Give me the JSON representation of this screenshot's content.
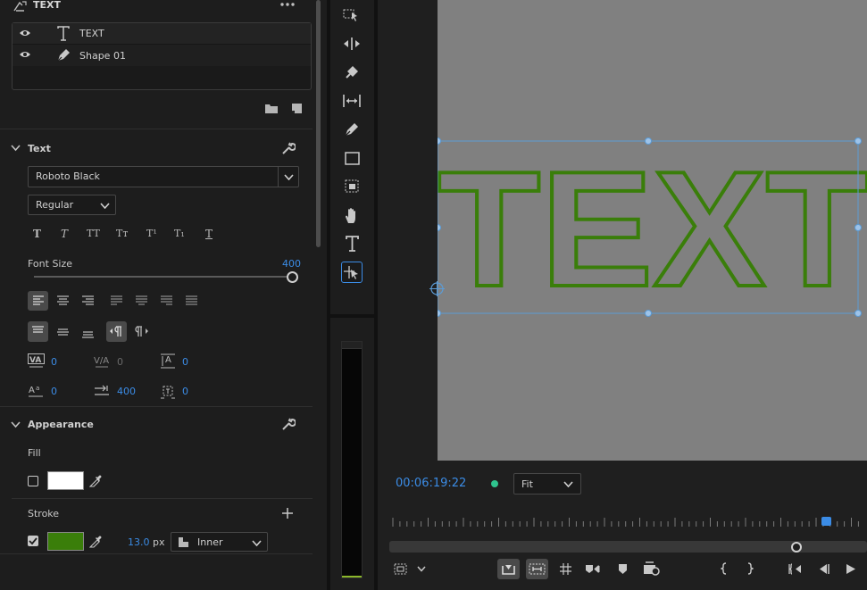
{
  "panel": {
    "title": "TEXT",
    "layers": [
      {
        "name": "TEXT",
        "icon": "text-layer-icon"
      },
      {
        "name": "Shape 01",
        "icon": "pen-icon"
      }
    ]
  },
  "text_section": {
    "title": "Text",
    "font_family": "Roboto Black",
    "font_style": "Regular",
    "style_buttons": [
      "T",
      "T",
      "TT",
      "Tт",
      "T¹",
      "T₁",
      "T"
    ],
    "font_size_label": "Font Size",
    "font_size_value": "400",
    "font_size_slider_fraction": 1.0,
    "tracking": "0",
    "kerning": "0",
    "leading": "0",
    "baseline_shift": "0",
    "tab_width": "400",
    "tsume": "0"
  },
  "appearance_section": {
    "title": "Appearance",
    "fill_label": "Fill",
    "fill_color": "#ffffff",
    "fill_checked": false,
    "stroke_label": "Stroke",
    "stroke_checked": true,
    "stroke_color": "#3a7e0a",
    "stroke_width": "13.0",
    "stroke_unit": "px",
    "stroke_position": "Inner"
  },
  "monitor": {
    "canvas_text": "TEXT",
    "text_outline_color": "#3a7e0a",
    "timecode": "00:06:19:22",
    "zoom": "Fit"
  },
  "colors": {
    "accent": "#3b8ce6",
    "panel_bg": "#1d1d1d",
    "canvas_bg": "#808080",
    "selection": "#5b9bd5",
    "status_dot": "#2fc48e"
  }
}
